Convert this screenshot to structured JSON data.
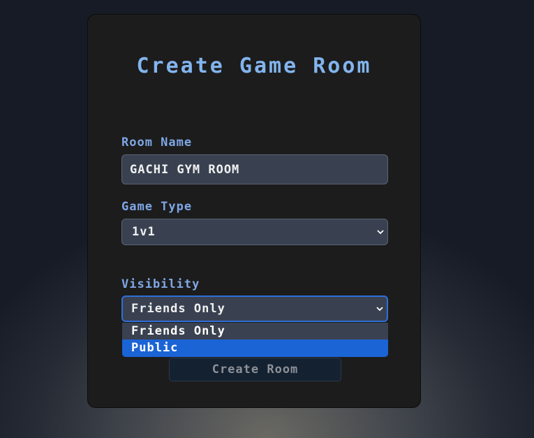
{
  "form": {
    "title": "Create Game Room",
    "room_name_label": "Room Name",
    "room_name_value": "GACHI GYM ROOM",
    "game_type_label": "Game Type",
    "game_type_value": "1v1",
    "visibility_label": "Visibility",
    "visibility_value": "Friends Only",
    "visibility_options": [
      "Friends Only",
      "Public"
    ],
    "visibility_highlighted": "Public",
    "submit_label": "Create Room"
  },
  "icons": {
    "select_arrow": "chevron-down-icon"
  },
  "colors": {
    "accent": "#82b4ee",
    "label": "#7fa7e6",
    "field_bg": "#394151",
    "panel_bg": "#1c1c1c",
    "highlight": "#1b64d6",
    "focus_border": "#2f6fdb",
    "button_bg": "#142131"
  }
}
